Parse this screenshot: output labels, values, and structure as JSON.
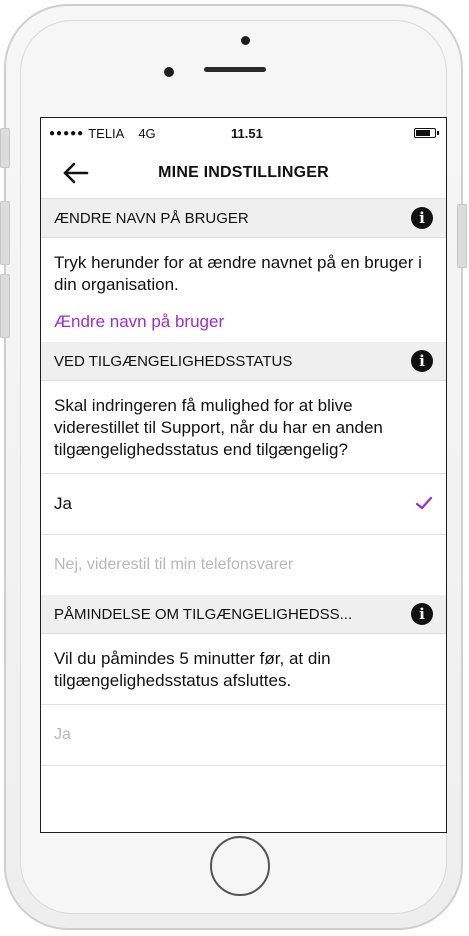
{
  "statusbar": {
    "signal": "●●●●●",
    "carrier": "TELIA",
    "network": "4G",
    "time": "11.51",
    "battery_level": 0.8
  },
  "navbar": {
    "title": "MINE INDSTILLINGER"
  },
  "section1": {
    "title": "ÆNDRE NAVN PÅ BRUGER",
    "description": "Tryk herunder for at ændre navnet på en bruger i din organisation.",
    "link": "Ændre navn på bruger"
  },
  "section2": {
    "title": "VED TILGÆNGELIGHEDSSTATUS",
    "description": "Skal indringeren få mulighed for at blive viderestillet til Support, når du har en anden tilgængelighedsstatus end tilgængelig?",
    "options": [
      {
        "label": "Ja",
        "selected": true
      },
      {
        "label": "Nej, viderestil til min telefonsvarer",
        "selected": false
      }
    ]
  },
  "section3": {
    "title": "PÅMINDELSE OM TILGÆNGELIGHEDSS...",
    "description": "Vil du påmindes 5 minutter før, at din tilgængelighedsstatus afsluttes.",
    "options": [
      {
        "label": "Ja",
        "selected": false
      }
    ]
  },
  "icons": {
    "info": "i",
    "accent_color": "#9b2bd8"
  }
}
